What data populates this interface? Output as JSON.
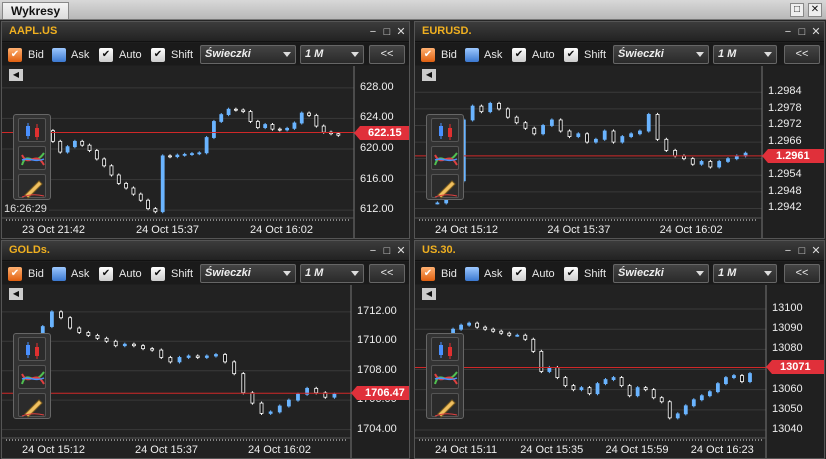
{
  "window": {
    "title": "Wykresy",
    "minimize_icon": "−",
    "restore_icon": "□",
    "close_icon": "✕"
  },
  "common": {
    "bid_label": "Bid",
    "ask_label": "Ask",
    "auto_label": "Auto",
    "shift_label": "Shift",
    "chart_type": "Świeczki",
    "interval": "1 M",
    "back_label": "<<",
    "scroll_left": "◀",
    "checked": "✔",
    "panel_min": "−",
    "panel_restore": "□",
    "panel_close": "✕"
  },
  "colors": {
    "up": "#6ab4ff",
    "down": "#ffffff",
    "price_line": "#d02828",
    "badge": "#e0303a",
    "symbol": "#f0b020"
  },
  "panels": [
    {
      "symbol": "AAPL.US",
      "price": "622.15",
      "crosshair_time": "16:26:29",
      "y_ticks": [
        "628.00",
        "624.00",
        "620.00",
        "616.00",
        "612.00"
      ],
      "x_ticks": [
        "23 Oct 21:42",
        "24 Oct 15:37",
        "24 Oct 16:02"
      ]
    },
    {
      "symbol": "EURUSD.",
      "price": "1.2961",
      "y_ticks": [
        "1.2984",
        "1.2978",
        "1.2972",
        "1.2966",
        "1.2960",
        "1.2954",
        "1.2948",
        "1.2942"
      ],
      "x_ticks": [
        "24 Oct 15:12",
        "24 Oct 15:37",
        "24 Oct 16:02"
      ]
    },
    {
      "symbol": "GOLDs.",
      "price": "1706.47",
      "y_ticks": [
        "1712.00",
        "1710.00",
        "1708.00",
        "1706.00",
        "1704.00"
      ],
      "x_ticks": [
        "24 Oct 15:12",
        "24 Oct 15:37",
        "24 Oct 16:02"
      ]
    },
    {
      "symbol": "US.30.",
      "price": "13071",
      "y_ticks": [
        "13100",
        "13090",
        "13080",
        "13070",
        "13060",
        "13050",
        "13040"
      ],
      "x_ticks": [
        "24 Oct 15:11",
        "24 Oct 15:35",
        "24 Oct 15:59",
        "24 Oct 16:23"
      ]
    }
  ],
  "chart_data": [
    {
      "type": "candlestick",
      "title": "AAPL.US",
      "ylim": [
        611.5,
        628.5
      ],
      "y_ticks": [
        628,
        624,
        620,
        616,
        612
      ],
      "current_price": 622.15,
      "close": [
        621.5,
        621.2,
        621.9,
        622.4,
        621.0,
        619.6,
        620.3,
        621.0,
        620.5,
        619.8,
        618.7,
        617.8,
        616.6,
        615.5,
        614.9,
        614.1,
        613.3,
        612.2,
        611.8,
        619.1,
        619.0,
        619.2,
        619.3,
        619.4,
        619.5,
        621.5,
        623.6,
        624.5,
        625.2,
        625.1,
        624.9,
        623.6,
        622.8,
        623.2,
        622.6,
        622.5,
        622.7,
        623.4,
        624.7,
        624.4,
        623.0,
        622.2,
        622.0,
        621.8
      ]
    },
    {
      "type": "candlestick",
      "title": "EURUSD.",
      "ylim": [
        1.294,
        1.2987
      ],
      "y_ticks": [
        1.2984,
        1.2978,
        1.2972,
        1.2966,
        1.296,
        1.2954,
        1.2948,
        1.2942
      ],
      "current_price": 1.2961,
      "close": [
        1.2944,
        1.2946,
        1.2952,
        1.2974,
        1.2979,
        1.2977,
        1.298,
        1.2978,
        1.2975,
        1.2973,
        1.2971,
        1.2969,
        1.2972,
        1.2974,
        1.297,
        1.2968,
        1.2969,
        1.2966,
        1.2967,
        1.297,
        1.2966,
        1.2968,
        1.2969,
        1.297,
        1.2976,
        1.2967,
        1.2963,
        1.2961,
        1.296,
        1.2958,
        1.2959,
        1.2957,
        1.2959,
        1.296,
        1.2961,
        1.2962
      ]
    },
    {
      "type": "candlestick",
      "title": "GOLDs.",
      "ylim": [
        1703.7,
        1712.6
      ],
      "y_ticks": [
        1712,
        1710,
        1708,
        1706,
        1704
      ],
      "current_price": 1706.47,
      "close": [
        1710.1,
        1710.4,
        1711.0,
        1712.0,
        1711.6,
        1710.9,
        1710.6,
        1710.4,
        1710.2,
        1710.0,
        1709.7,
        1709.8,
        1709.7,
        1709.5,
        1709.4,
        1708.9,
        1708.6,
        1708.9,
        1709.0,
        1708.9,
        1709.0,
        1709.1,
        1708.6,
        1707.8,
        1706.5,
        1705.8,
        1705.1,
        1705.2,
        1705.6,
        1706.0,
        1706.4,
        1706.8,
        1706.5,
        1706.2,
        1706.4
      ]
    },
    {
      "type": "candlestick",
      "title": "US.30.",
      "ylim": [
        13038,
        13103
      ],
      "y_ticks": [
        13100,
        13090,
        13080,
        13070,
        13060,
        13050,
        13040
      ],
      "current_price": 13071,
      "close": [
        13082,
        13086,
        13090,
        13092,
        13093,
        13091,
        13090,
        13089,
        13088,
        13087,
        13087,
        13085,
        13079,
        13069,
        13071,
        13066,
        13062,
        13060,
        13061,
        13058,
        13063,
        13065,
        13066,
        13062,
        13057,
        13061,
        13060,
        13056,
        13054,
        13046,
        13048,
        13052,
        13055,
        13057,
        13059,
        13063,
        13066,
        13067,
        13064,
        13068
      ]
    }
  ]
}
